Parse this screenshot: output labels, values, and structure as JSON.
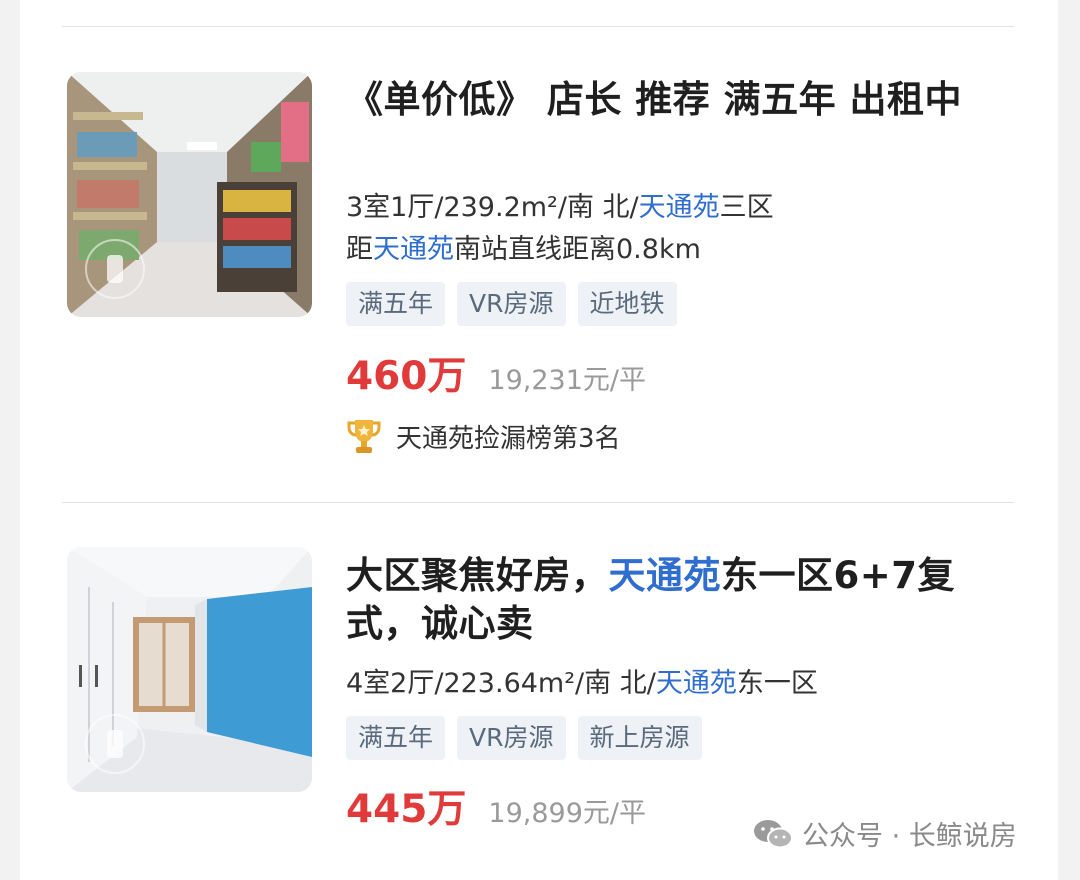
{
  "listings": [
    {
      "title": "《单价低》 店长 推荐  满五年 出租中",
      "layout": "3室1厅/239.2m²/南 北/",
      "community": "天通苑",
      "area": "三区",
      "distance_prefix": "距",
      "distance_community": "天通苑",
      "distance_suffix": "南站直线距离0.8km",
      "tags": [
        "满五年",
        "VR房源",
        "近地铁"
      ],
      "price": "460万",
      "unit_price": "19,231元/平",
      "rank_text": "天通苑捡漏榜第3名"
    },
    {
      "title_part1": "大区聚焦好房，",
      "title_highlight": "天通苑",
      "title_part2": "东一区6+7复式，诚心卖",
      "layout": "4室2厅/223.64m²/南 北/",
      "community": "天通苑",
      "area": "东一区",
      "tags": [
        "满五年",
        "VR房源",
        "新上房源"
      ],
      "price": "445万",
      "unit_price": "19,899元/平"
    }
  ],
  "watermark": {
    "text": "公众号 · 长鲸说房"
  },
  "colors": {
    "price": "#e03a3a",
    "highlight": "#2f6dce",
    "tag_bg": "#eef2f6",
    "tag_text": "#5a6a7c"
  }
}
